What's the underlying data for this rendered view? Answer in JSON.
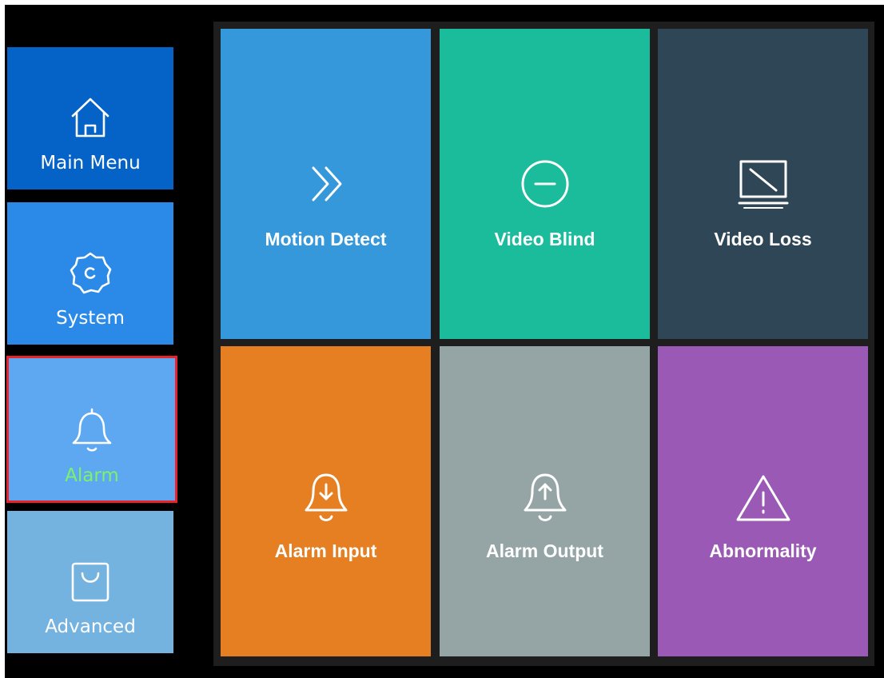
{
  "sidebar": {
    "items": [
      {
        "label": "Main Menu",
        "icon": "home-icon",
        "color": "#0563c8"
      },
      {
        "label": "System",
        "icon": "gear-icon",
        "color": "#2b8ae8"
      },
      {
        "label": "Alarm",
        "icon": "bell-icon",
        "color": "#5ea8f2",
        "selected": true,
        "label_color": "#7cf26a",
        "border_color": "#e8232a"
      },
      {
        "label": "Advanced",
        "icon": "bag-icon",
        "color": "#74b3e0"
      }
    ]
  },
  "grid": {
    "tiles": [
      {
        "label": "Motion Detect",
        "icon": "double-chevron-right-icon",
        "color": "#3498db"
      },
      {
        "label": "Video Blind",
        "icon": "minus-circle-icon",
        "color": "#1abc9c"
      },
      {
        "label": "Video Loss",
        "icon": "monitor-slash-icon",
        "color": "#2f4656"
      },
      {
        "label": "Alarm Input",
        "icon": "bell-arrow-down-icon",
        "color": "#e67e22"
      },
      {
        "label": "Alarm Output",
        "icon": "bell-arrow-up-icon",
        "color": "#95a5a6"
      },
      {
        "label": "Abnormality",
        "icon": "warning-triangle-icon",
        "color": "#9b59b6"
      }
    ]
  }
}
